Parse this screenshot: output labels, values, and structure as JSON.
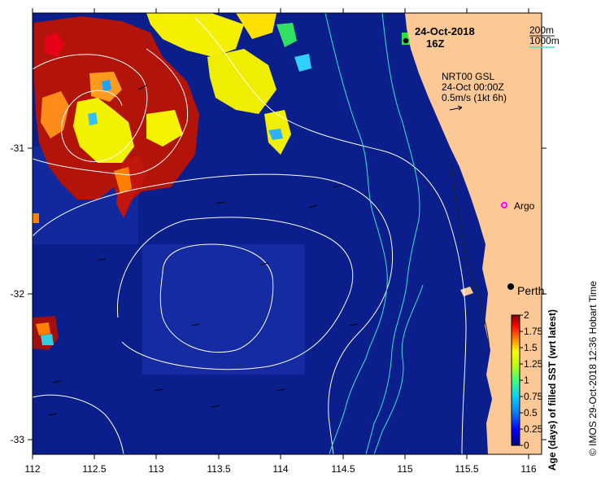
{
  "header": {
    "date": "24-Oct-2018",
    "time": "16Z"
  },
  "depth_legend": {
    "shallow": "200m",
    "deep": "1000m",
    "colors": {
      "200m": "#1a1a1a",
      "1000m": "#40e0d0"
    }
  },
  "current_info": {
    "line1": "NRT00 GSL",
    "line2": "24-Oct 00:00Z",
    "line3": "0.5m/s (1kt 6h)"
  },
  "places": {
    "argo": "Argo",
    "perth": "Perth"
  },
  "axes": {
    "x_ticks": [
      "112",
      "112.5",
      "113",
      "113.5",
      "114",
      "114.5",
      "115",
      "115.5",
      "116"
    ],
    "y_ticks": [
      "-31",
      "-32",
      "-33"
    ]
  },
  "colorbar": {
    "title": "Age (days) of filled SST (wrt latest)",
    "ticks": [
      "2",
      "1.75",
      "1.5",
      "1.25",
      "1",
      "0.75",
      "0.5",
      "0.25",
      "0"
    ],
    "colors": [
      "#00007f",
      "#0000ff",
      "#0080ff",
      "#00d0ff",
      "#40ff80",
      "#c0ff00",
      "#ffff00",
      "#ff8000",
      "#ff0000",
      "#800000"
    ]
  },
  "credit": "© IMOS 29-Oct-2018 12:36 Hobart Time",
  "colors": {
    "ocean": "#0a1e8c",
    "land": "#fbc896",
    "contour": "#ffffff"
  }
}
